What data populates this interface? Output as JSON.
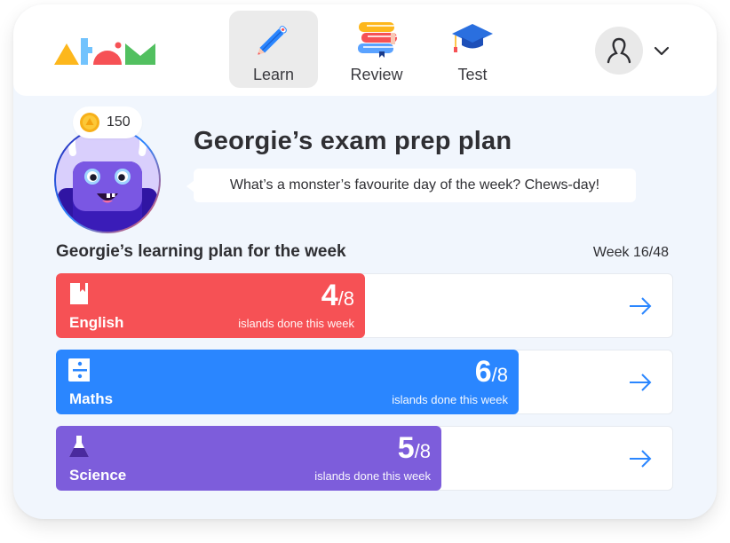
{
  "brand": {
    "name": "atom"
  },
  "nav": {
    "items": [
      {
        "label": "Learn",
        "icon": "pencil-icon",
        "active": true
      },
      {
        "label": "Review",
        "icon": "books-icon",
        "active": false
      },
      {
        "label": "Test",
        "icon": "graduation-cap-icon",
        "active": false
      }
    ]
  },
  "user_menu": {
    "icon": "user-icon",
    "dropdown_icon": "chevron-down-icon"
  },
  "profile": {
    "coins": "150",
    "coin_icon": "coin-icon",
    "avatar": "monster-avatar"
  },
  "header": {
    "title": "Georgie’s exam prep plan",
    "joke": "What’s a monster’s favourite day of the week? Chews-day!"
  },
  "plan": {
    "title": "Georgie’s learning plan for the week",
    "week": "Week 16/48",
    "caption": "islands done this week",
    "subjects": [
      {
        "name": "English",
        "done": "4",
        "total": "/8",
        "progress": 0.5,
        "color": "#f65155",
        "icon": "book-icon"
      },
      {
        "name": "Maths",
        "done": "6",
        "total": "/8",
        "progress": 0.75,
        "color": "#2a86ff",
        "icon": "divide-icon"
      },
      {
        "name": "Science",
        "done": "5",
        "total": "/8",
        "progress": 0.625,
        "color": "#7d5ddb",
        "icon": "flask-icon"
      }
    ]
  },
  "colors": {
    "accent_blue": "#2a86ff",
    "background": "#f1f6fd"
  }
}
